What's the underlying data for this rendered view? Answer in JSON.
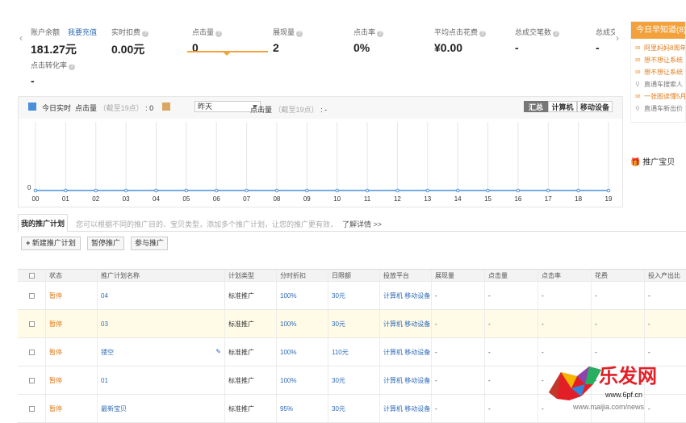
{
  "metrics": [
    {
      "label": "账户余额",
      "value": "181.27元",
      "link": "我要充值"
    },
    {
      "label": "实时扣费",
      "value": "0.00元"
    },
    {
      "label": "点击量",
      "value": "0"
    },
    {
      "label": "展现量",
      "value": "2"
    },
    {
      "label": "点击率",
      "value": "0%"
    },
    {
      "label": "平均点击花费",
      "value": "¥0.00"
    },
    {
      "label": "总成交笔数",
      "value": "-"
    },
    {
      "label": "总成交",
      "value": "-"
    },
    {
      "label": "点击转化率",
      "value": "-"
    }
  ],
  "news": {
    "title": "今日早知道(8)",
    "items": [
      {
        "icon": "mail-icon",
        "text": "阿里妈妈8周年"
      },
      {
        "icon": "mail-icon",
        "text": "想不想让系统"
      },
      {
        "icon": "mail-icon",
        "text": "想不想让系统"
      },
      {
        "icon": "pin-icon",
        "text": "直通车搜索人"
      },
      {
        "icon": "mail-icon",
        "text": "一张图读懂5月"
      },
      {
        "icon": "pin-icon",
        "text": "直通车新出价"
      }
    ]
  },
  "promo": "推广宝贝",
  "chart_panel": {
    "today_label": "今日实时",
    "today_metric": "点击量",
    "today_note": "（截至19点）",
    "today_value": ": 0",
    "compare_select": "昨天",
    "compare_metric": "点击量",
    "compare_note": "（截至19点）",
    "compare_value": ": -",
    "segments": [
      "汇总",
      "计算机",
      "移动设备"
    ],
    "active_segment": "汇总",
    "today_color": "#4a8fdc",
    "compare_color": "#d9a760"
  },
  "chart_data": {
    "type": "line",
    "x": [
      "00",
      "01",
      "02",
      "03",
      "04",
      "05",
      "06",
      "07",
      "08",
      "09",
      "10",
      "11",
      "12",
      "13",
      "14",
      "15",
      "16",
      "17",
      "18",
      "19"
    ],
    "series": [
      {
        "values": [
          0,
          0,
          0,
          0,
          0,
          0,
          0,
          0,
          0,
          0,
          0,
          0,
          0,
          0,
          0,
          0,
          0,
          0,
          0,
          0
        ]
      }
    ],
    "ytick": "0",
    "color": "#4a8fdc"
  },
  "tabs": {
    "active": "我的推广计划",
    "note": "您可以根据不同的推广目的、宝贝类型，添加多个推广计划，让您的推广更有效，",
    "more": "了解详情 >>"
  },
  "buttons": {
    "new_plan": "新建推广计划",
    "pause": "暂停推广",
    "join": "参与推广"
  },
  "table": {
    "headers": [
      "",
      "状态",
      "推广计划名称",
      "计划类型",
      "分时折扣",
      "日限额",
      "投放平台",
      "展现量",
      "点击量",
      "点击率",
      "花费",
      "投入产出比"
    ],
    "rows": [
      {
        "status": "暂停",
        "name": "04",
        "type": "标准推广",
        "discount": "100%",
        "limit": "30元",
        "platform": "计算机 移动设备",
        "impr": "-",
        "clicks": "-",
        "ctr": "-",
        "cost": "-",
        "roi": "-"
      },
      {
        "status": "暂停",
        "name": "03",
        "type": "标准推广",
        "discount": "100%",
        "limit": "30元",
        "platform": "计算机 移动设备",
        "impr": "-",
        "clicks": "-",
        "ctr": "-",
        "cost": "-",
        "roi": "-"
      },
      {
        "status": "暂停",
        "name": "镂空",
        "type": "标准推广",
        "discount": "100%",
        "limit": "110元",
        "platform": "计算机 移动设备",
        "impr": "-",
        "clicks": "-",
        "ctr": "-",
        "cost": "-",
        "roi": "-"
      },
      {
        "status": "暂停",
        "name": "01",
        "type": "标准推广",
        "discount": "100%",
        "limit": "30元",
        "platform": "计算机 移动设备",
        "impr": "-",
        "clicks": "-",
        "ctr": "-",
        "cost": "-",
        "roi": "-"
      },
      {
        "status": "暂停",
        "name": "最新宝贝",
        "type": "标准推广",
        "discount": "95%",
        "limit": "30元",
        "platform": "计算机 移动设备",
        "impr": "-",
        "clicks": "-",
        "ctr": "-",
        "cost": "-",
        "roi": "-"
      }
    ]
  },
  "watermark": {
    "title": "乐发网",
    "url": "www.6pf.cn",
    "source": "www.maijia.com/news"
  }
}
